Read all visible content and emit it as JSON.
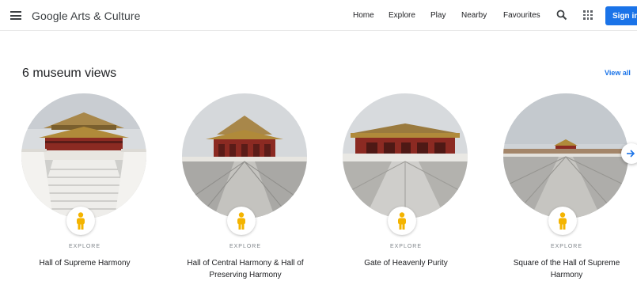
{
  "header": {
    "logo": "Google Arts & Culture",
    "nav": [
      "Home",
      "Explore",
      "Play",
      "Nearby",
      "Favourites"
    ],
    "signin": "Sign in"
  },
  "section": {
    "title": "6 museum views",
    "view_all": "View all"
  },
  "cards": [
    {
      "label": "EXPLORE",
      "title": "Hall of Supreme Harmony"
    },
    {
      "label": "EXPLORE",
      "title": "Hall of Central Harmony & Hall of Preserving Harmony"
    },
    {
      "label": "EXPLORE",
      "title": "Gate of Heavenly Purity"
    },
    {
      "label": "EXPLORE",
      "title": "Square of the Hall of Supreme Harmony"
    }
  ],
  "colors": {
    "accent": "#1a73e8",
    "pegman": "#f4b400",
    "roof": "#b08a3a",
    "wall": "#8b2a22"
  },
  "icons": {
    "menu": "menu-icon",
    "search": "search-icon",
    "apps": "apps-grid-icon",
    "pegman": "pegman-icon",
    "next": "arrow-right-icon"
  }
}
